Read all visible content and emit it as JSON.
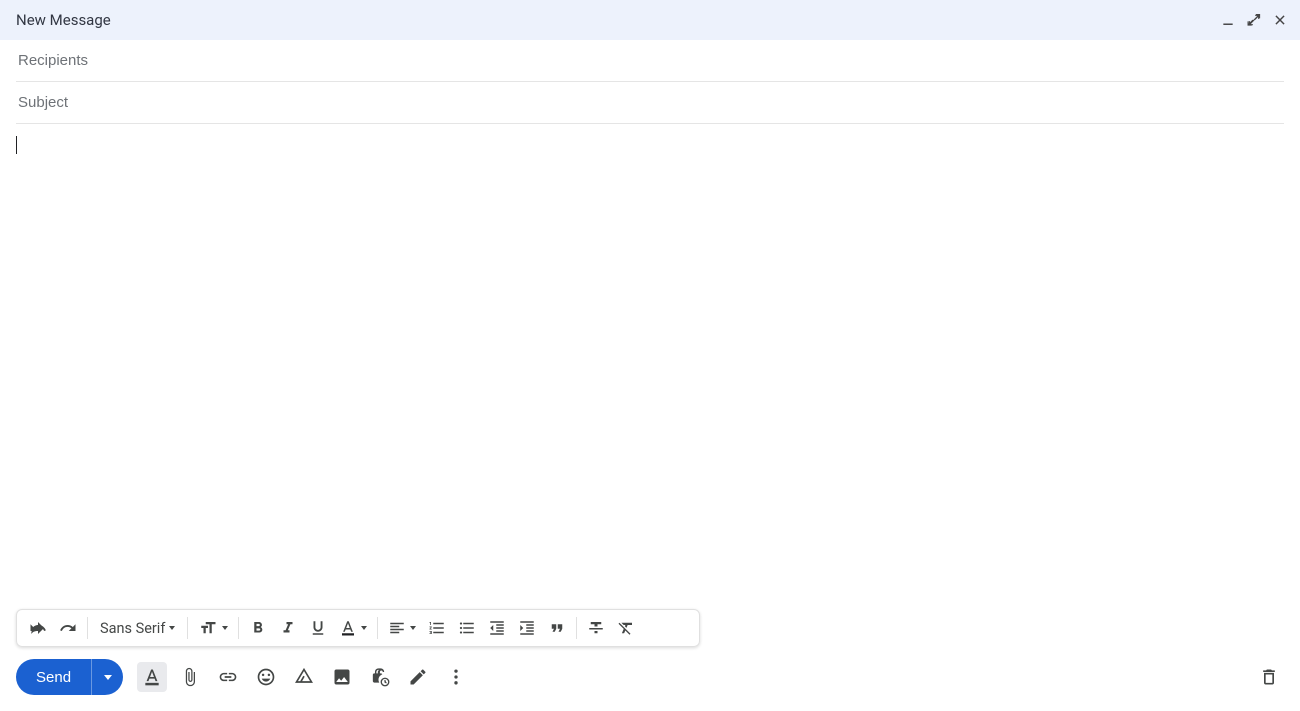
{
  "header": {
    "title": "New Message"
  },
  "fields": {
    "recipients_placeholder": "Recipients",
    "recipients_value": "",
    "subject_placeholder": "Subject",
    "subject_value": ""
  },
  "body": {
    "content": ""
  },
  "format_toolbar": {
    "font_family": "Sans Serif"
  },
  "actions": {
    "send_label": "Send"
  },
  "icons": {
    "minimize": "minimize-icon",
    "restore": "restore-icon",
    "close": "close-icon",
    "undo": "undo-icon",
    "redo": "redo-icon",
    "font_size": "font-size-icon",
    "bold": "bold-icon",
    "italic": "italic-icon",
    "underline": "underline-icon",
    "text_color": "text-color-icon",
    "align": "align-icon",
    "numbered_list": "numbered-list-icon",
    "bulleted_list": "bulleted-list-icon",
    "indent_less": "indent-less-icon",
    "indent_more": "indent-more-icon",
    "quote": "quote-icon",
    "strikethrough": "strikethrough-icon",
    "remove_formatting": "remove-formatting-icon",
    "formatting_options": "text-format-icon",
    "attach": "paperclip-icon",
    "link": "link-icon",
    "emoji": "emoji-icon",
    "drive": "drive-icon",
    "image": "image-icon",
    "confidential": "lock-clock-icon",
    "signature": "pen-icon",
    "more": "more-vert-icon",
    "discard": "trash-icon",
    "send_options": "caret-down-icon"
  }
}
